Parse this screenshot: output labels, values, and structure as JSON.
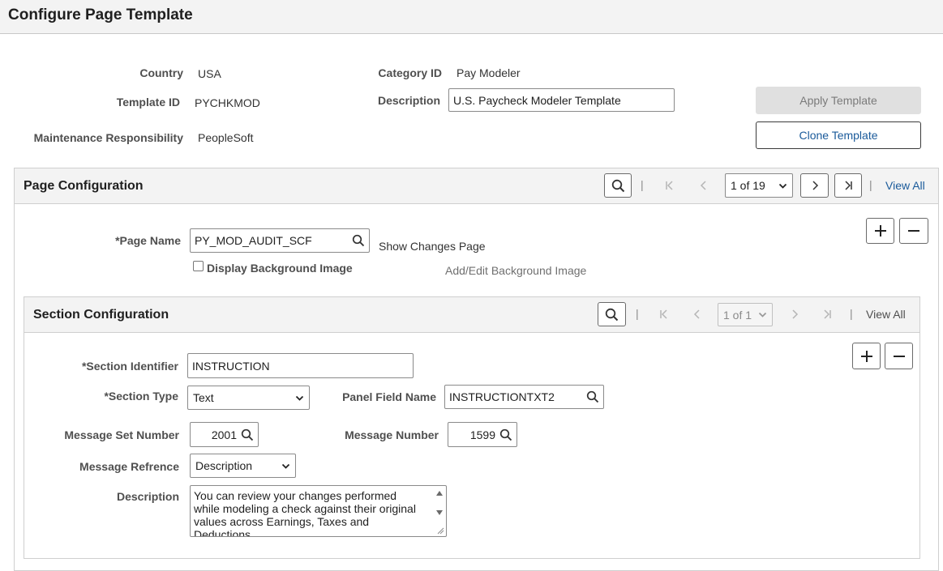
{
  "page": {
    "title": "Configure Page Template"
  },
  "header_fields": {
    "country_label": "Country",
    "country_value": "USA",
    "template_id_label": "Template ID",
    "template_id_value": "PYCHKMOD",
    "maint_label": "Maintenance Responsibility",
    "maint_value": "PeopleSoft",
    "category_label": "Category ID",
    "category_value": "Pay Modeler",
    "description_label": "Description",
    "description_value": "U.S. Paycheck Modeler Template"
  },
  "actions": {
    "apply_template": "Apply Template",
    "clone_template": "Clone Template"
  },
  "page_config": {
    "title": "Page Configuration",
    "separator": "|",
    "pager": "1 of 19",
    "view_all": "View All",
    "page_name_label": "*Page Name",
    "page_name_value": "PY_MOD_AUDIT_SCF",
    "show_changes": "Show Changes Page",
    "display_bg_label": "Display Background Image",
    "add_edit_bg": "Add/Edit Background Image"
  },
  "section_config": {
    "title": "Section Configuration",
    "pager": "1 of 1",
    "view_all": "View All",
    "section_id_label": "*Section Identifier",
    "section_id_value": "INSTRUCTION",
    "section_type_label": "*Section Type",
    "section_type_value": "Text",
    "panel_field_label": "Panel Field Name",
    "panel_field_value": "INSTRUCTIONTXT2",
    "msg_set_label": "Message Set Number",
    "msg_set_value": "2001",
    "msg_num_label": "Message Number",
    "msg_num_value": "1599",
    "msg_ref_label": "Message Refrence",
    "msg_ref_value": "Description",
    "description_label": "Description",
    "description_lines": [
      "You can review your changes performed",
      "while modeling a check against their original",
      "values across Earnings, Taxes and",
      "Deductions"
    ]
  },
  "colors": {
    "link": "#1a5a9a",
    "header_bg": "#f3f3f3",
    "button_disabled_bg": "#e0e0e0"
  }
}
